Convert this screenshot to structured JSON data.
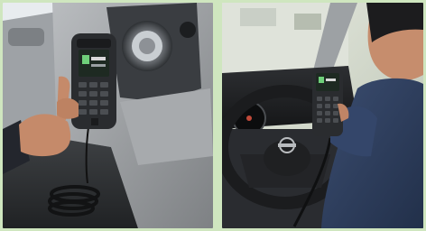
{
  "figure": {
    "panels": [
      {
        "id": "left",
        "subject": "handheld-radio-with-coiled-cord-in-car-interior"
      },
      {
        "id": "right",
        "subject": "driver-using-handheld-radio-in-nissan-vehicle"
      }
    ],
    "colors": {
      "border": "#cfe6bf",
      "radio_body": "#2a2c2f",
      "screen": "#1e2a22",
      "dash_gray": "#8f9295",
      "shirt_blue": "#2f3f5e"
    }
  }
}
